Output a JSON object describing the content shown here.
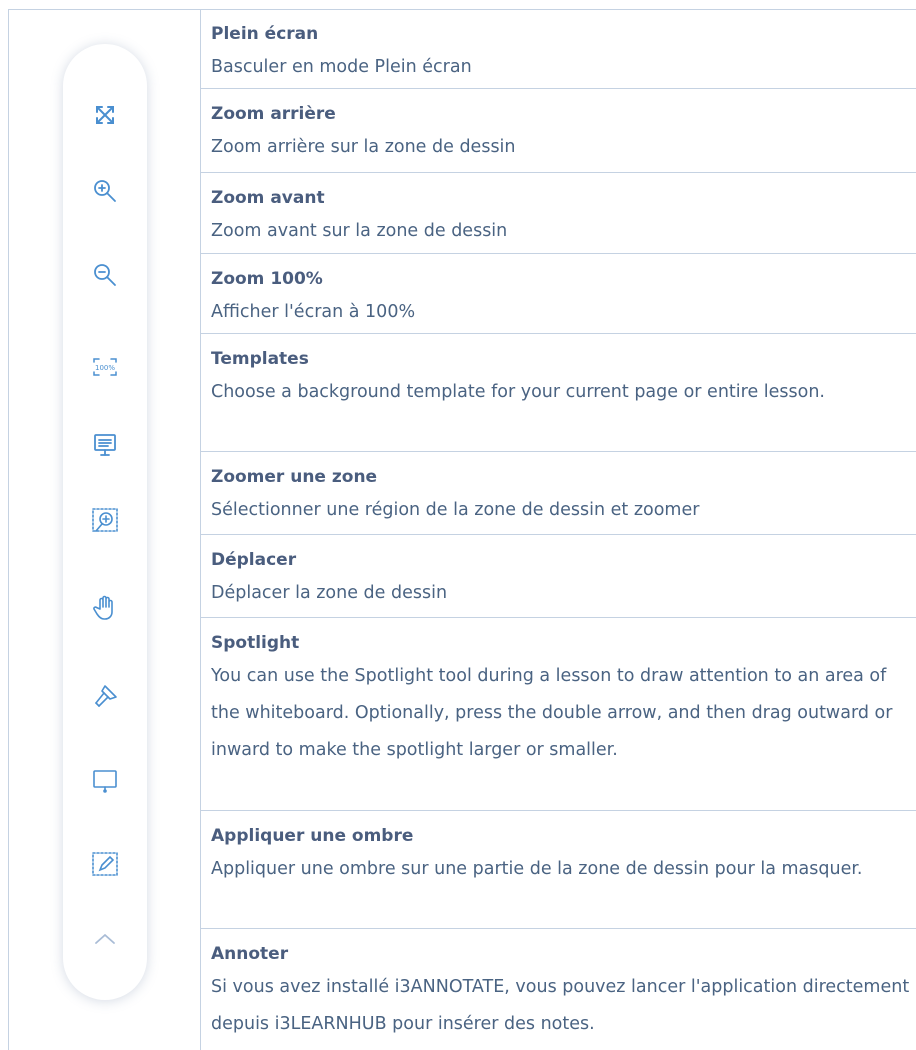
{
  "toolbar": {
    "icons": [
      "fullscreen-icon",
      "zoom-in-icon",
      "zoom-out-icon",
      "zoom-100-icon",
      "templates-icon",
      "zoom-area-icon",
      "pan-hand-icon",
      "spotlight-icon",
      "screen-shade-icon",
      "annotate-icon",
      "collapse-chevron-icon"
    ],
    "accent_color": "#4a8fd0"
  },
  "rows": [
    {
      "title": "Plein écran",
      "description": "Basculer en mode Plein écran"
    },
    {
      "title": "Zoom arrière",
      "description": "Zoom arrière sur la zone de dessin"
    },
    {
      "title": "Zoom avant",
      "description": "Zoom avant sur la zone de dessin"
    },
    {
      "title": "Zoom 100%",
      "description": "Afficher l'écran à 100%"
    },
    {
      "title": "Templates",
      "description": "Choose a background template for your current page or entire lesson."
    },
    {
      "title": "Zoomer une zone",
      "description": "Sélectionner une région de la zone de dessin et zoomer"
    },
    {
      "title": "Déplacer",
      "description": "Déplacer la zone de dessin"
    },
    {
      "title": "Spotlight",
      "description": "You can use the Spotlight tool during a lesson to draw attention to an area of the whiteboard. Optionally, press the double arrow, and then drag outward or inward to make the spotlight larger or smaller."
    },
    {
      "title": "Appliquer une ombre",
      "description": "Appliquer une ombre sur une partie de la zone de dessin pour la masquer."
    },
    {
      "title": "Annoter",
      "description": "Si vous avez installé i3ANNOTATE, vous pouvez lancer l'application directement depuis i3LEARNHUB pour insérer des notes."
    }
  ],
  "zoom_100_icon_text": "100%"
}
